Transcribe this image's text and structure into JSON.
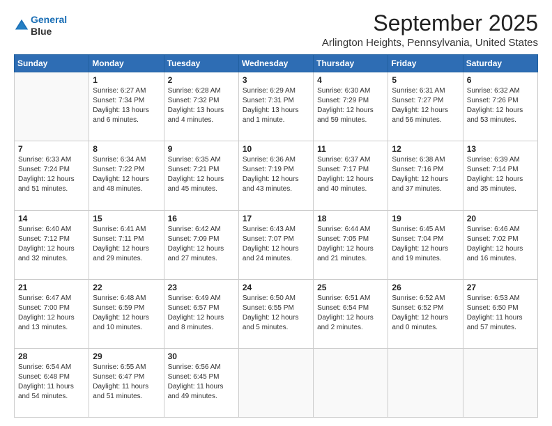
{
  "header": {
    "logo_line1": "General",
    "logo_line2": "Blue",
    "month": "September 2025",
    "location": "Arlington Heights, Pennsylvania, United States"
  },
  "weekdays": [
    "Sunday",
    "Monday",
    "Tuesday",
    "Wednesday",
    "Thursday",
    "Friday",
    "Saturday"
  ],
  "weeks": [
    [
      {
        "day": "",
        "info": ""
      },
      {
        "day": "1",
        "info": "Sunrise: 6:27 AM\nSunset: 7:34 PM\nDaylight: 13 hours\nand 6 minutes."
      },
      {
        "day": "2",
        "info": "Sunrise: 6:28 AM\nSunset: 7:32 PM\nDaylight: 13 hours\nand 4 minutes."
      },
      {
        "day": "3",
        "info": "Sunrise: 6:29 AM\nSunset: 7:31 PM\nDaylight: 13 hours\nand 1 minute."
      },
      {
        "day": "4",
        "info": "Sunrise: 6:30 AM\nSunset: 7:29 PM\nDaylight: 12 hours\nand 59 minutes."
      },
      {
        "day": "5",
        "info": "Sunrise: 6:31 AM\nSunset: 7:27 PM\nDaylight: 12 hours\nand 56 minutes."
      },
      {
        "day": "6",
        "info": "Sunrise: 6:32 AM\nSunset: 7:26 PM\nDaylight: 12 hours\nand 53 minutes."
      }
    ],
    [
      {
        "day": "7",
        "info": "Sunrise: 6:33 AM\nSunset: 7:24 PM\nDaylight: 12 hours\nand 51 minutes."
      },
      {
        "day": "8",
        "info": "Sunrise: 6:34 AM\nSunset: 7:22 PM\nDaylight: 12 hours\nand 48 minutes."
      },
      {
        "day": "9",
        "info": "Sunrise: 6:35 AM\nSunset: 7:21 PM\nDaylight: 12 hours\nand 45 minutes."
      },
      {
        "day": "10",
        "info": "Sunrise: 6:36 AM\nSunset: 7:19 PM\nDaylight: 12 hours\nand 43 minutes."
      },
      {
        "day": "11",
        "info": "Sunrise: 6:37 AM\nSunset: 7:17 PM\nDaylight: 12 hours\nand 40 minutes."
      },
      {
        "day": "12",
        "info": "Sunrise: 6:38 AM\nSunset: 7:16 PM\nDaylight: 12 hours\nand 37 minutes."
      },
      {
        "day": "13",
        "info": "Sunrise: 6:39 AM\nSunset: 7:14 PM\nDaylight: 12 hours\nand 35 minutes."
      }
    ],
    [
      {
        "day": "14",
        "info": "Sunrise: 6:40 AM\nSunset: 7:12 PM\nDaylight: 12 hours\nand 32 minutes."
      },
      {
        "day": "15",
        "info": "Sunrise: 6:41 AM\nSunset: 7:11 PM\nDaylight: 12 hours\nand 29 minutes."
      },
      {
        "day": "16",
        "info": "Sunrise: 6:42 AM\nSunset: 7:09 PM\nDaylight: 12 hours\nand 27 minutes."
      },
      {
        "day": "17",
        "info": "Sunrise: 6:43 AM\nSunset: 7:07 PM\nDaylight: 12 hours\nand 24 minutes."
      },
      {
        "day": "18",
        "info": "Sunrise: 6:44 AM\nSunset: 7:05 PM\nDaylight: 12 hours\nand 21 minutes."
      },
      {
        "day": "19",
        "info": "Sunrise: 6:45 AM\nSunset: 7:04 PM\nDaylight: 12 hours\nand 19 minutes."
      },
      {
        "day": "20",
        "info": "Sunrise: 6:46 AM\nSunset: 7:02 PM\nDaylight: 12 hours\nand 16 minutes."
      }
    ],
    [
      {
        "day": "21",
        "info": "Sunrise: 6:47 AM\nSunset: 7:00 PM\nDaylight: 12 hours\nand 13 minutes."
      },
      {
        "day": "22",
        "info": "Sunrise: 6:48 AM\nSunset: 6:59 PM\nDaylight: 12 hours\nand 10 minutes."
      },
      {
        "day": "23",
        "info": "Sunrise: 6:49 AM\nSunset: 6:57 PM\nDaylight: 12 hours\nand 8 minutes."
      },
      {
        "day": "24",
        "info": "Sunrise: 6:50 AM\nSunset: 6:55 PM\nDaylight: 12 hours\nand 5 minutes."
      },
      {
        "day": "25",
        "info": "Sunrise: 6:51 AM\nSunset: 6:54 PM\nDaylight: 12 hours\nand 2 minutes."
      },
      {
        "day": "26",
        "info": "Sunrise: 6:52 AM\nSunset: 6:52 PM\nDaylight: 12 hours\nand 0 minutes."
      },
      {
        "day": "27",
        "info": "Sunrise: 6:53 AM\nSunset: 6:50 PM\nDaylight: 11 hours\nand 57 minutes."
      }
    ],
    [
      {
        "day": "28",
        "info": "Sunrise: 6:54 AM\nSunset: 6:48 PM\nDaylight: 11 hours\nand 54 minutes."
      },
      {
        "day": "29",
        "info": "Sunrise: 6:55 AM\nSunset: 6:47 PM\nDaylight: 11 hours\nand 51 minutes."
      },
      {
        "day": "30",
        "info": "Sunrise: 6:56 AM\nSunset: 6:45 PM\nDaylight: 11 hours\nand 49 minutes."
      },
      {
        "day": "",
        "info": ""
      },
      {
        "day": "",
        "info": ""
      },
      {
        "day": "",
        "info": ""
      },
      {
        "day": "",
        "info": ""
      }
    ]
  ]
}
